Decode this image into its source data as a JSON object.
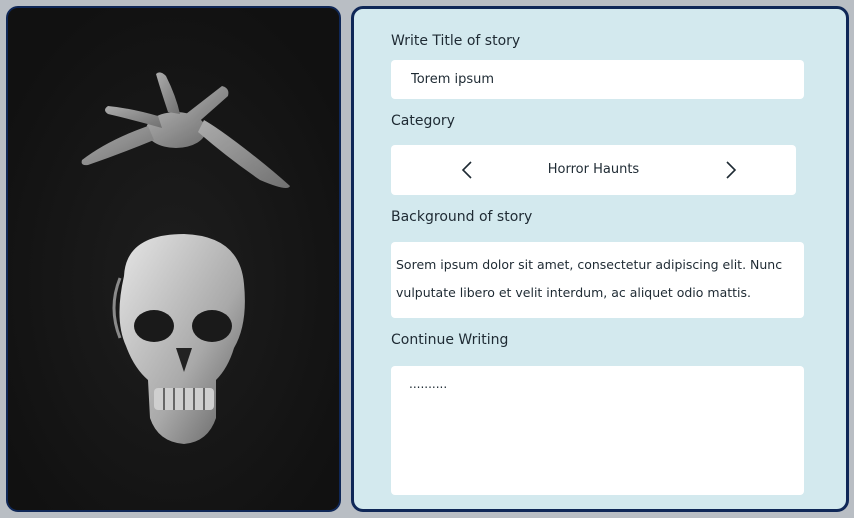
{
  "title_field": {
    "label": "Write Title of story",
    "value": "Torem ipsum"
  },
  "category": {
    "label": "Category",
    "value": "Horror Haunts",
    "prev_icon": "chevron-left-icon",
    "next_icon": "chevron-right-icon"
  },
  "background": {
    "label": "Background  of story",
    "text": "Sorem ipsum dolor sit amet, consectetur adipiscing elit. Nunc vulputate libero et velit interdum, ac aliquet odio mattis."
  },
  "continue_writing": {
    "label": "Continue Writing",
    "value": ".........."
  },
  "colors": {
    "page_background": "#b9bec4",
    "card_border": "#0f2757",
    "form_panel": "#d3e9ee",
    "image_background": "#161616"
  }
}
